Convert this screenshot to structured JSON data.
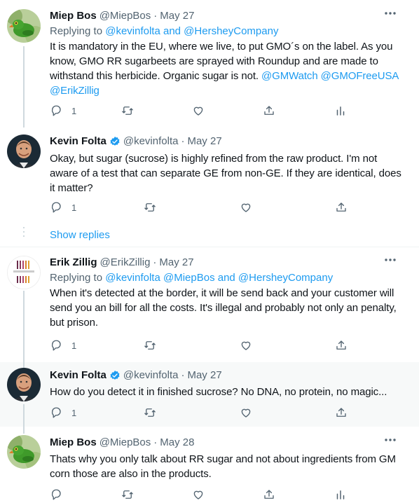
{
  "tweets": [
    {
      "name": "Miep Bos",
      "handle": "@MiepBos",
      "date": "May 27",
      "replying_label": "Replying to ",
      "replying_to": "@kevinfolta and @HersheyCompany",
      "body_line1": "It is mandatory in the EU, where we live, to put GMO´s on the label. As you",
      "body_line2": "know, GMO RR sugarbeets are sprayed with Roundup and are made to",
      "body_line3": "withstand this herbicide. Organic sugar is not.",
      "mention1": "@GMWatch",
      "mention2": "@GMOFreeUSA",
      "mention3": "@ErikZillig",
      "reply_count": "1"
    },
    {
      "name": "Kevin Folta",
      "handle": "@kevinfolta",
      "date": "May 27",
      "body_line1": "Okay, but sugar (sucrose) is highly refined from the raw product. I'm not",
      "body_line2": "aware of a test that can separate GE from non-GE. If they are identical, does",
      "body_line3": "it matter?",
      "reply_count": "1"
    },
    {
      "name": "Erik Zillig",
      "handle": "@ErikZillig",
      "date": "May 27",
      "replying_label": "Replying to ",
      "replying_to": "@kevinfolta @MiepBos and @HersheyCompany",
      "body_line1": "When it's detected at the border, it will be send back and your customer will",
      "body_line2": "send you an bill for all the costs. It's illegal and probably not only an penalty,",
      "body_line3": "but prison.",
      "reply_count": "1",
      "avatar_text": "Thoughts For Food"
    },
    {
      "name": "Kevin Folta",
      "handle": "@kevinfolta",
      "date": "May 27",
      "body_line1": "How do you detect it in finished sucrose?  No DNA, no protein, no magic...",
      "reply_count": "1"
    },
    {
      "name": "Miep Bos",
      "handle": "@MiepBos",
      "date": "May 28",
      "body_line1": "Thats why you only talk about RR sugar and not about ingredients from GM",
      "body_line2": "corn those are also in the products."
    }
  ],
  "show_replies_label": "Show replies",
  "separator_dot": "·",
  "colors": {
    "accent": "#1d9bf0",
    "secondary_text": "#536471",
    "primary_text": "#0f1419"
  },
  "icons": [
    "reply-icon",
    "retweet-icon",
    "like-icon",
    "share-icon",
    "analytics-icon",
    "more-icon",
    "verified-badge-icon"
  ]
}
